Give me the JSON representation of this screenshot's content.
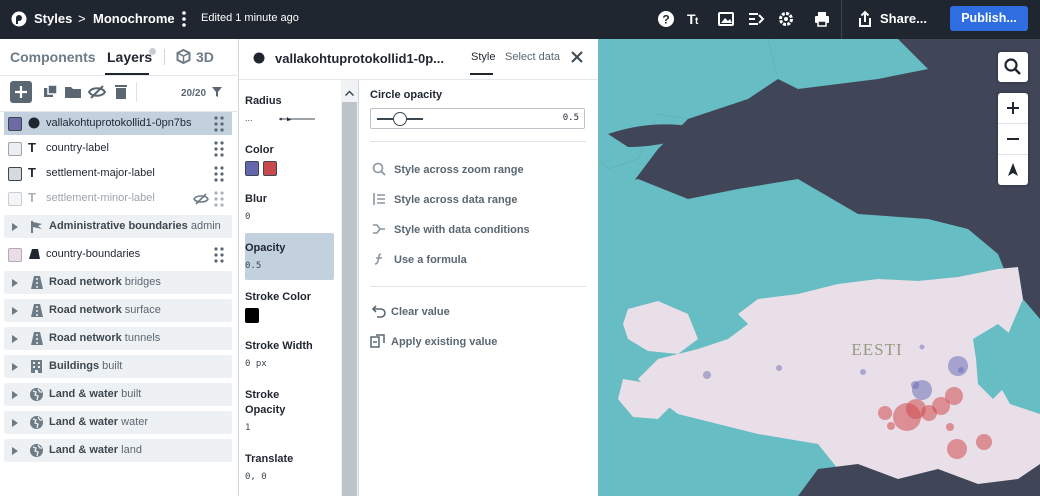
{
  "header": {
    "styles_label": "Styles",
    "separator": ">",
    "style_name": "Monochrome",
    "edited": "Edited 1 minute ago",
    "share_label": "Share...",
    "publish_label": "Publish..."
  },
  "left_panel": {
    "tabs": {
      "components": "Components",
      "layers": "Layers",
      "three_d": "3D"
    },
    "layer_count": "20/20",
    "layers": [
      {
        "name": "vallakohtuprotokollid1-0pn7bs",
        "type": "circle",
        "selected": true,
        "hidden": false
      },
      {
        "name": "country-label",
        "type": "symbol",
        "selected": false,
        "hidden": false
      },
      {
        "name": "settlement-major-label",
        "type": "symbol",
        "selected": false,
        "hidden": false
      },
      {
        "name": "settlement-minor-label",
        "type": "symbol",
        "selected": false,
        "hidden": true
      },
      {
        "name": "country-boundaries",
        "type": "fill",
        "selected": false,
        "hidden": false
      }
    ],
    "groups": [
      {
        "name": "Administrative boundaries",
        "suffix": "admin",
        "icon": "flag-icon"
      },
      {
        "name": "Road network",
        "suffix": "bridges",
        "icon": "road-icon"
      },
      {
        "name": "Road network",
        "suffix": "surface",
        "icon": "road-icon"
      },
      {
        "name": "Road network",
        "suffix": "tunnels",
        "icon": "road-icon"
      },
      {
        "name": "Buildings",
        "suffix": "built",
        "icon": "building-icon"
      },
      {
        "name": "Land & water",
        "suffix": "built",
        "icon": "globe-icon"
      },
      {
        "name": "Land & water",
        "suffix": "water",
        "icon": "globe-icon"
      },
      {
        "name": "Land & water",
        "suffix": "land",
        "icon": "globe-icon"
      }
    ]
  },
  "editor": {
    "layer_title": "vallakohtuprotokollid1-0p...",
    "tabs": {
      "style": "Style",
      "select_data": "Select data"
    },
    "properties": {
      "radius": {
        "label": "Radius",
        "value": "..."
      },
      "color": {
        "label": "Color",
        "swatches": [
          "#6466ae",
          "#c94a4e"
        ]
      },
      "blur": {
        "label": "Blur",
        "value": "0"
      },
      "opacity": {
        "label": "Opacity",
        "value": "0.5"
      },
      "stroke_color": {
        "label": "Stroke Color",
        "swatch": "#000000"
      },
      "stroke_width": {
        "label": "Stroke Width",
        "value": "0 px"
      },
      "stroke_opacity": {
        "label_line1": "Stroke",
        "label_line2": "Opacity",
        "value": "1"
      },
      "translate": {
        "label": "Translate",
        "value": "0, 0"
      }
    },
    "detail": {
      "title": "Circle opacity",
      "slider_value": "0.5",
      "slider_fraction": 0.5,
      "actions": [
        {
          "label": "Style across zoom range",
          "icon": "zoom-range-icon"
        },
        {
          "label": "Style across data range",
          "icon": "data-range-icon"
        },
        {
          "label": "Style with data conditions",
          "icon": "conditions-icon"
        },
        {
          "label": "Use a formula",
          "icon": "formula-icon"
        }
      ],
      "secondary_actions": [
        {
          "label": "Clear value",
          "icon": "undo-icon"
        },
        {
          "label": "Apply existing value",
          "icon": "apply-icon"
        }
      ]
    }
  },
  "map": {
    "country_label": "EESTI",
    "colors": {
      "water": "#66bdc3",
      "land": "#e8dfe8",
      "background": "#404658"
    }
  }
}
